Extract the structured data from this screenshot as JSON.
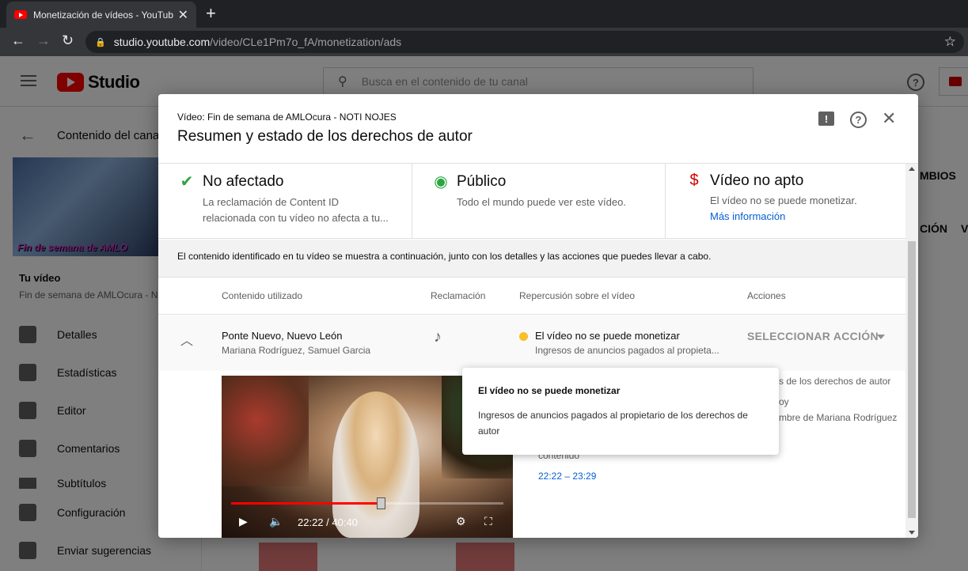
{
  "browser": {
    "tab_title": "Monetización de vídeos - YouTube Studio",
    "url_host": "studio.youtube.com",
    "url_path": "/video/CLe1Pm7o_fA/monetization/ads"
  },
  "studio": {
    "brand": "Studio",
    "search_placeholder": "Busca en el contenido de tu canal",
    "back_label": "Contenido del canal",
    "thumb_text": "Fin de semana de AMLO",
    "your_video_label": "Tu vídeo",
    "your_video_title": "Fin de semana de AMLOcura - NOTI NOJES",
    "nav": [
      {
        "label": "Detalles",
        "icon": "pencil-icon"
      },
      {
        "label": "Estadísticas",
        "icon": "analytics-icon"
      },
      {
        "label": "Editor",
        "icon": "film-icon"
      },
      {
        "label": "Comentarios",
        "icon": "comment-icon"
      },
      {
        "label": "Subtítulos",
        "icon": "subtitles-icon"
      }
    ],
    "bottom_nav": [
      {
        "label": "Configuración",
        "icon": "gear-icon"
      },
      {
        "label": "Enviar sugerencias",
        "icon": "feedback-icon"
      }
    ],
    "right_partial_1": "MBIOS",
    "right_partial_2": "CIÓN",
    "right_partial_3": "V"
  },
  "modal": {
    "subtitle": "Vídeo: Fin de semana de AMLOcura - NOTI NOJES",
    "title": "Resumen y estado de los derechos de autor",
    "cards": [
      {
        "heading": "No afectado",
        "body_line1": "La reclamación de Content ID",
        "body_line2": "relacionada con tu vídeo no afecta a tu...",
        "icon": "check-circle-icon",
        "color": "#2ba640"
      },
      {
        "heading": "Público",
        "body_line1": "Todo el mundo puede ver este vídeo.",
        "icon": "eye-icon",
        "color": "#2ba640"
      },
      {
        "heading": "Vídeo no apto",
        "body_line1": "El vídeo no se puede monetizar.",
        "link": "Más información",
        "icon": "no-money-icon",
        "color": "#cc0000"
      }
    ],
    "info_text": "El contenido identificado en tu vídeo se muestra a continuación, junto con los detalles y las acciones que puedes llevar a cabo.",
    "table": {
      "headers": [
        "Contenido utilizado",
        "Reclamación",
        "Repercusión sobre el vídeo",
        "Acciones"
      ],
      "row": {
        "song": "Ponte Nuevo, Nuevo León",
        "artists": "Mariana Rodríguez, Samuel Garcia",
        "impact": "El vídeo no se puede monetizar",
        "impact_detail": "Ingresos de anuncios pagados al propieta...",
        "action": "SELECCIONAR ACCIÓN"
      }
    },
    "player": {
      "time": "22:22 / 40:40",
      "progress": 0.55
    },
    "details": {
      "line1": "s de los derechos de autor",
      "line2": "oy",
      "line3": "mbre de Mariana Rodríguez",
      "line4": "contenido",
      "range": "22:22 – 23:29"
    },
    "tooltip": {
      "title": "El vídeo no se puede monetizar",
      "body": "Ingresos de anuncios pagados al propietario de los derechos de autor"
    }
  }
}
